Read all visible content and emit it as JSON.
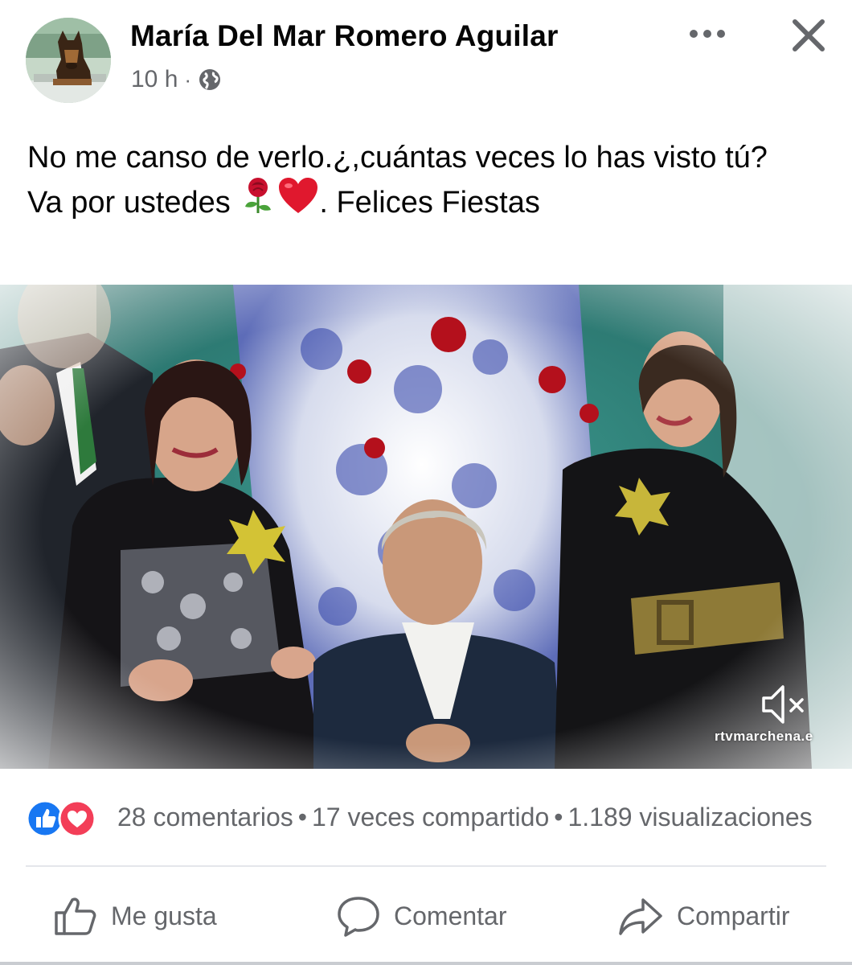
{
  "post": {
    "author": "María Del Mar Romero Aguilar",
    "time": "10 h",
    "meta_separator": "·",
    "privacy_icon": "globe-icon",
    "text_lines": [
      "No me canso de verlo.¿,cuántas veces lo has visto tú?",
      "Va por ustedes",
      ". Felices Fiestas"
    ],
    "emojis": [
      "rose",
      "red-heart"
    ]
  },
  "video": {
    "watermark": "rtvmarchena.e",
    "muted": true
  },
  "stats": {
    "reaction_icons": [
      "like-icon",
      "love-icon"
    ],
    "comments": "28 comentarios",
    "shares": "17 veces compartido",
    "views": "1.189 visualizaciones",
    "separator": "•"
  },
  "actions": {
    "like": "Me gusta",
    "comment": "Comentar",
    "share": "Compartir"
  },
  "colors": {
    "text_primary": "#050505",
    "text_secondary": "#65676b",
    "like_blue": "#1877f2",
    "love_red": "#f33e58",
    "divider": "#e4e6eb"
  }
}
